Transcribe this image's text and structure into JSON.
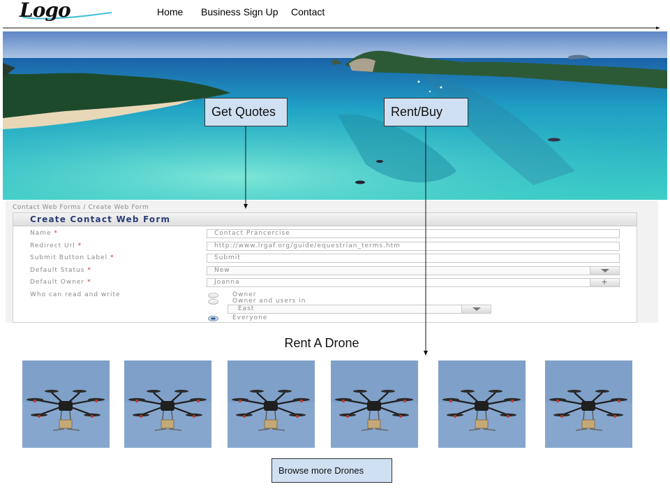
{
  "header": {
    "logo_text": "Logo",
    "nav": [
      {
        "label": "Home"
      },
      {
        "label": "Business Sign Up"
      },
      {
        "label": "Contact"
      }
    ]
  },
  "hero": {
    "callouts": {
      "get_quotes": "Get Quotes",
      "rent_buy": "Rent/Buy"
    }
  },
  "form": {
    "breadcrumb": "Contact Web Forms / Create Web Form",
    "heading": "Create Contact Web Form",
    "required_mark": "*",
    "fields": [
      {
        "label": "Name",
        "required": true,
        "value": "Contact Prancercise",
        "kind": "text"
      },
      {
        "label": "Redirect Url",
        "required": true,
        "value": "http://www.lrgaf.org/guide/equestrian_terms.htm",
        "kind": "text"
      },
      {
        "label": "Submit Button Label",
        "required": true,
        "value": "Submit",
        "kind": "text"
      },
      {
        "label": "Default Status",
        "required": true,
        "value": "New",
        "kind": "select"
      },
      {
        "label": "Default Owner",
        "required": true,
        "value": "Joanna",
        "kind": "lookup"
      }
    ],
    "permissions": {
      "label": "Who can read and write",
      "options": [
        {
          "label": "Owner",
          "selected": false
        },
        {
          "label": "Owner and users in",
          "selected": false
        },
        {
          "label": "Everyone",
          "selected": true
        }
      ],
      "group_value": "East"
    }
  },
  "drones": {
    "title": "Rent A Drone",
    "count": 6,
    "browse_label": "Browse more Drones"
  },
  "colors": {
    "callout_fill": "#cfe0f3",
    "sky": "#8aa9cf",
    "water": "#2fc4c9",
    "form_heading": "#2a3e78",
    "required": "#d03030"
  }
}
